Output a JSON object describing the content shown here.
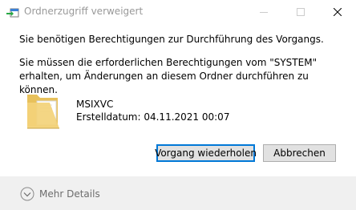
{
  "window": {
    "title": "Ordnerzugriff verweigert"
  },
  "message": {
    "line1": "Sie benötigen Berechtigungen zur Durchführung des Vorgangs.",
    "line2": "Sie müssen die erforderlichen Berechtigungen vom \"SYSTEM\" erhalten, um Änderungen an diesem Ordner durchführen zu können."
  },
  "item": {
    "icon": "folder-icon",
    "name": "MSIXVC",
    "date": "Erstelldatum: 04.11.2021 00:07"
  },
  "buttons": {
    "retry": "Vorgang wiederholen",
    "cancel": "Abbrechen"
  },
  "footer": {
    "details_label": "Mehr Details",
    "details_icon": "chevron-down-icon"
  },
  "colors": {
    "accent": "#0078d7",
    "footer_bg": "#f0f0f0",
    "button_bg": "#e1e1e1"
  }
}
